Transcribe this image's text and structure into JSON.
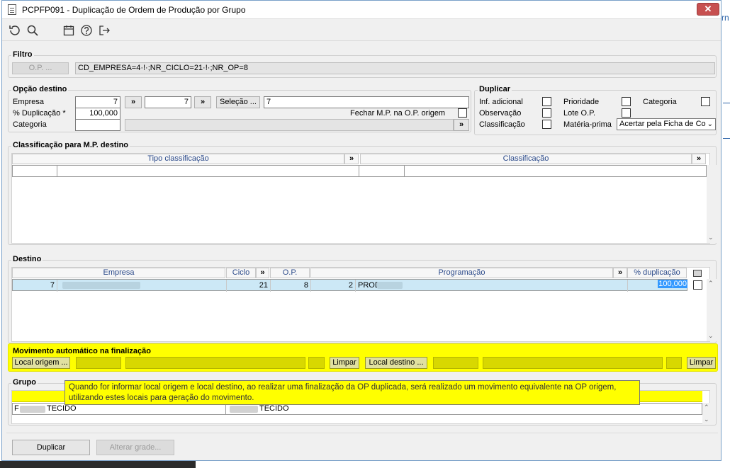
{
  "window": {
    "title": "PCPFP091 - Duplicação de Ordem de Produção por Grupo",
    "close": "✕"
  },
  "toolbar": {
    "icons": [
      "undo-icon",
      "search-icon",
      "calendar-icon",
      "help-icon",
      "exit-icon"
    ]
  },
  "filtro": {
    "legend": "Filtro",
    "op_button": "O.P. ...",
    "expression": "CD_EMPRESA=4·!·;NR_CICLO=21·!·;NR_OP=8"
  },
  "opcao_destino": {
    "legend": "Opção destino",
    "empresa_label": "Empresa",
    "empresa_value": "7",
    "empresa_value2": "7",
    "more": "»",
    "selecao_button": "Seleção ...",
    "selecao_value": "7",
    "duplicacao_label": "% Duplicação *",
    "duplicacao_value": "100,000",
    "fechar_label": "Fechar M.P. na O.P. origem",
    "categoria_label": "Categoria"
  },
  "duplicar": {
    "legend": "Duplicar",
    "inf_adicional": "Inf. adicional",
    "prioridade": "Prioridade",
    "categoria": "Categoria",
    "observacao": "Observação",
    "lote_op": "Lote O.P.",
    "classificacao": "Classificação",
    "materia_prima": "Matéria-prima",
    "materia_prima_value": "Acertar pela Ficha de Co"
  },
  "classificacao_mp": {
    "legend": "Classificação para M.P. destino",
    "col1": "Tipo classificação",
    "col2": "Classificação"
  },
  "destino": {
    "legend": "Destino",
    "cols": {
      "empresa": "Empresa",
      "ciclo": "Ciclo",
      "op": "O.P.",
      "programacao": "Programação",
      "duplicacao": "% duplicação"
    },
    "row": {
      "empresa": "7",
      "ciclo": "21",
      "op": "8",
      "prog_num": "2",
      "prog_text": "PROD",
      "duplicacao": "100,000"
    }
  },
  "movimento": {
    "legend": "Movimento automático na finalização",
    "local_origem": "Local origem ...",
    "local_destino": "Local destino ...",
    "limpar": "Limpar"
  },
  "grupo": {
    "legend": "Grupo",
    "row_left": "TECIDO",
    "row_left_prefix": "F",
    "row_right": "TECIDO"
  },
  "tooltip": {
    "line1": "Quando for informar local origem e local destino, ao realizar uma finalização da OP duplicada, será realizado um movimento equivalente na OP origem,",
    "line2": "utilizando estes locais para geração do movimento."
  },
  "footer": {
    "duplicar": "Duplicar",
    "alterar_grade": "Alterar grade..."
  },
  "background_window": {
    "fragment": "rn"
  },
  "colors": {
    "highlight": "#ffff00",
    "accent": "#2b4a8a",
    "row_selected": "#cce8f6",
    "close": "#c75050"
  }
}
